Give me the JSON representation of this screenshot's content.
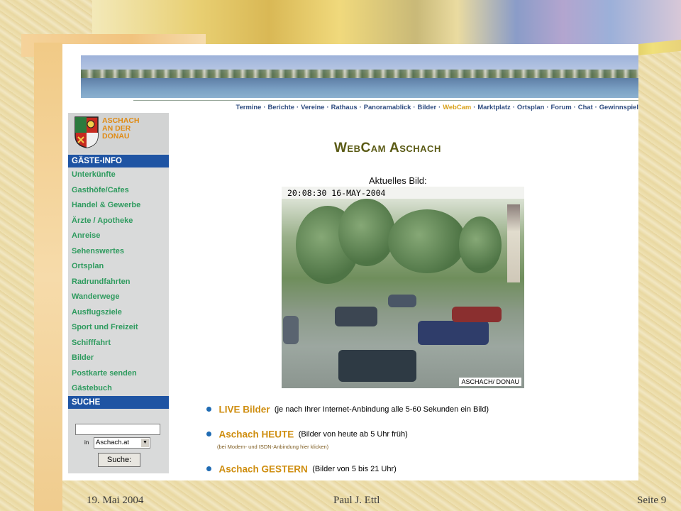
{
  "nav": {
    "items": [
      "Termine",
      "Berichte",
      "Vereine",
      "Rathaus",
      "Panoramablick",
      "Bilder",
      "WebCam",
      "Marktplatz",
      "Ortsplan",
      "Forum",
      "Chat",
      "Gewinnspiel"
    ],
    "active_index": 6
  },
  "logo": {
    "line1": "ASCHACH",
    "line2": "AN DER",
    "line3": "DONAU"
  },
  "sidebar": {
    "header": "GÄSTE-INFO",
    "items": [
      "Unterkünfte",
      "Gasthöfe/Cafes",
      "Handel & Gewerbe",
      "Ärzte / Apotheke",
      "Anreise",
      "Sehenswertes",
      "Ortsplan",
      "Radrundfahrten",
      "Wanderwege",
      "Ausflugsziele",
      "Sport und Freizeit",
      "Schifffahrt",
      "Bilder",
      "Postkarte senden",
      "Gästebuch"
    ],
    "search_header": "SUCHE",
    "search_value": "",
    "in_label": "in",
    "select_value": "Aschach.at",
    "search_button": "Suche:"
  },
  "main": {
    "title": "WebCam Aschach",
    "current_image_label": "Aktuelles Bild:",
    "timestamp": "20:08:30 16-MAY-2004",
    "caption": "ASCHACH/ DONAU",
    "links": [
      {
        "label": "LIVE Bilder",
        "desc": "(je nach Ihrer Internet-Anbindung alle 5-60 Sekunden ein Bild)"
      },
      {
        "label": "Aschach HEUTE",
        "desc": "(Bilder von heute ab 5 Uhr früh)",
        "note": "(bei Modem- und ISDN-Anbindung hier klicken)"
      },
      {
        "label": "Aschach GESTERN",
        "desc": "(Bilder von 5 bis 21 Uhr)"
      }
    ]
  },
  "footer": {
    "date": "19. Mai 2004",
    "author": "Paul J. Ettl",
    "page": "Seite 9"
  },
  "colors": {
    "sidebar_header": "#1f54a3",
    "sidebar_link": "#2f9b5f",
    "link_orange": "#cf8e10",
    "nav_blue": "#2d4b7f",
    "nav_active": "#d9a21b"
  }
}
